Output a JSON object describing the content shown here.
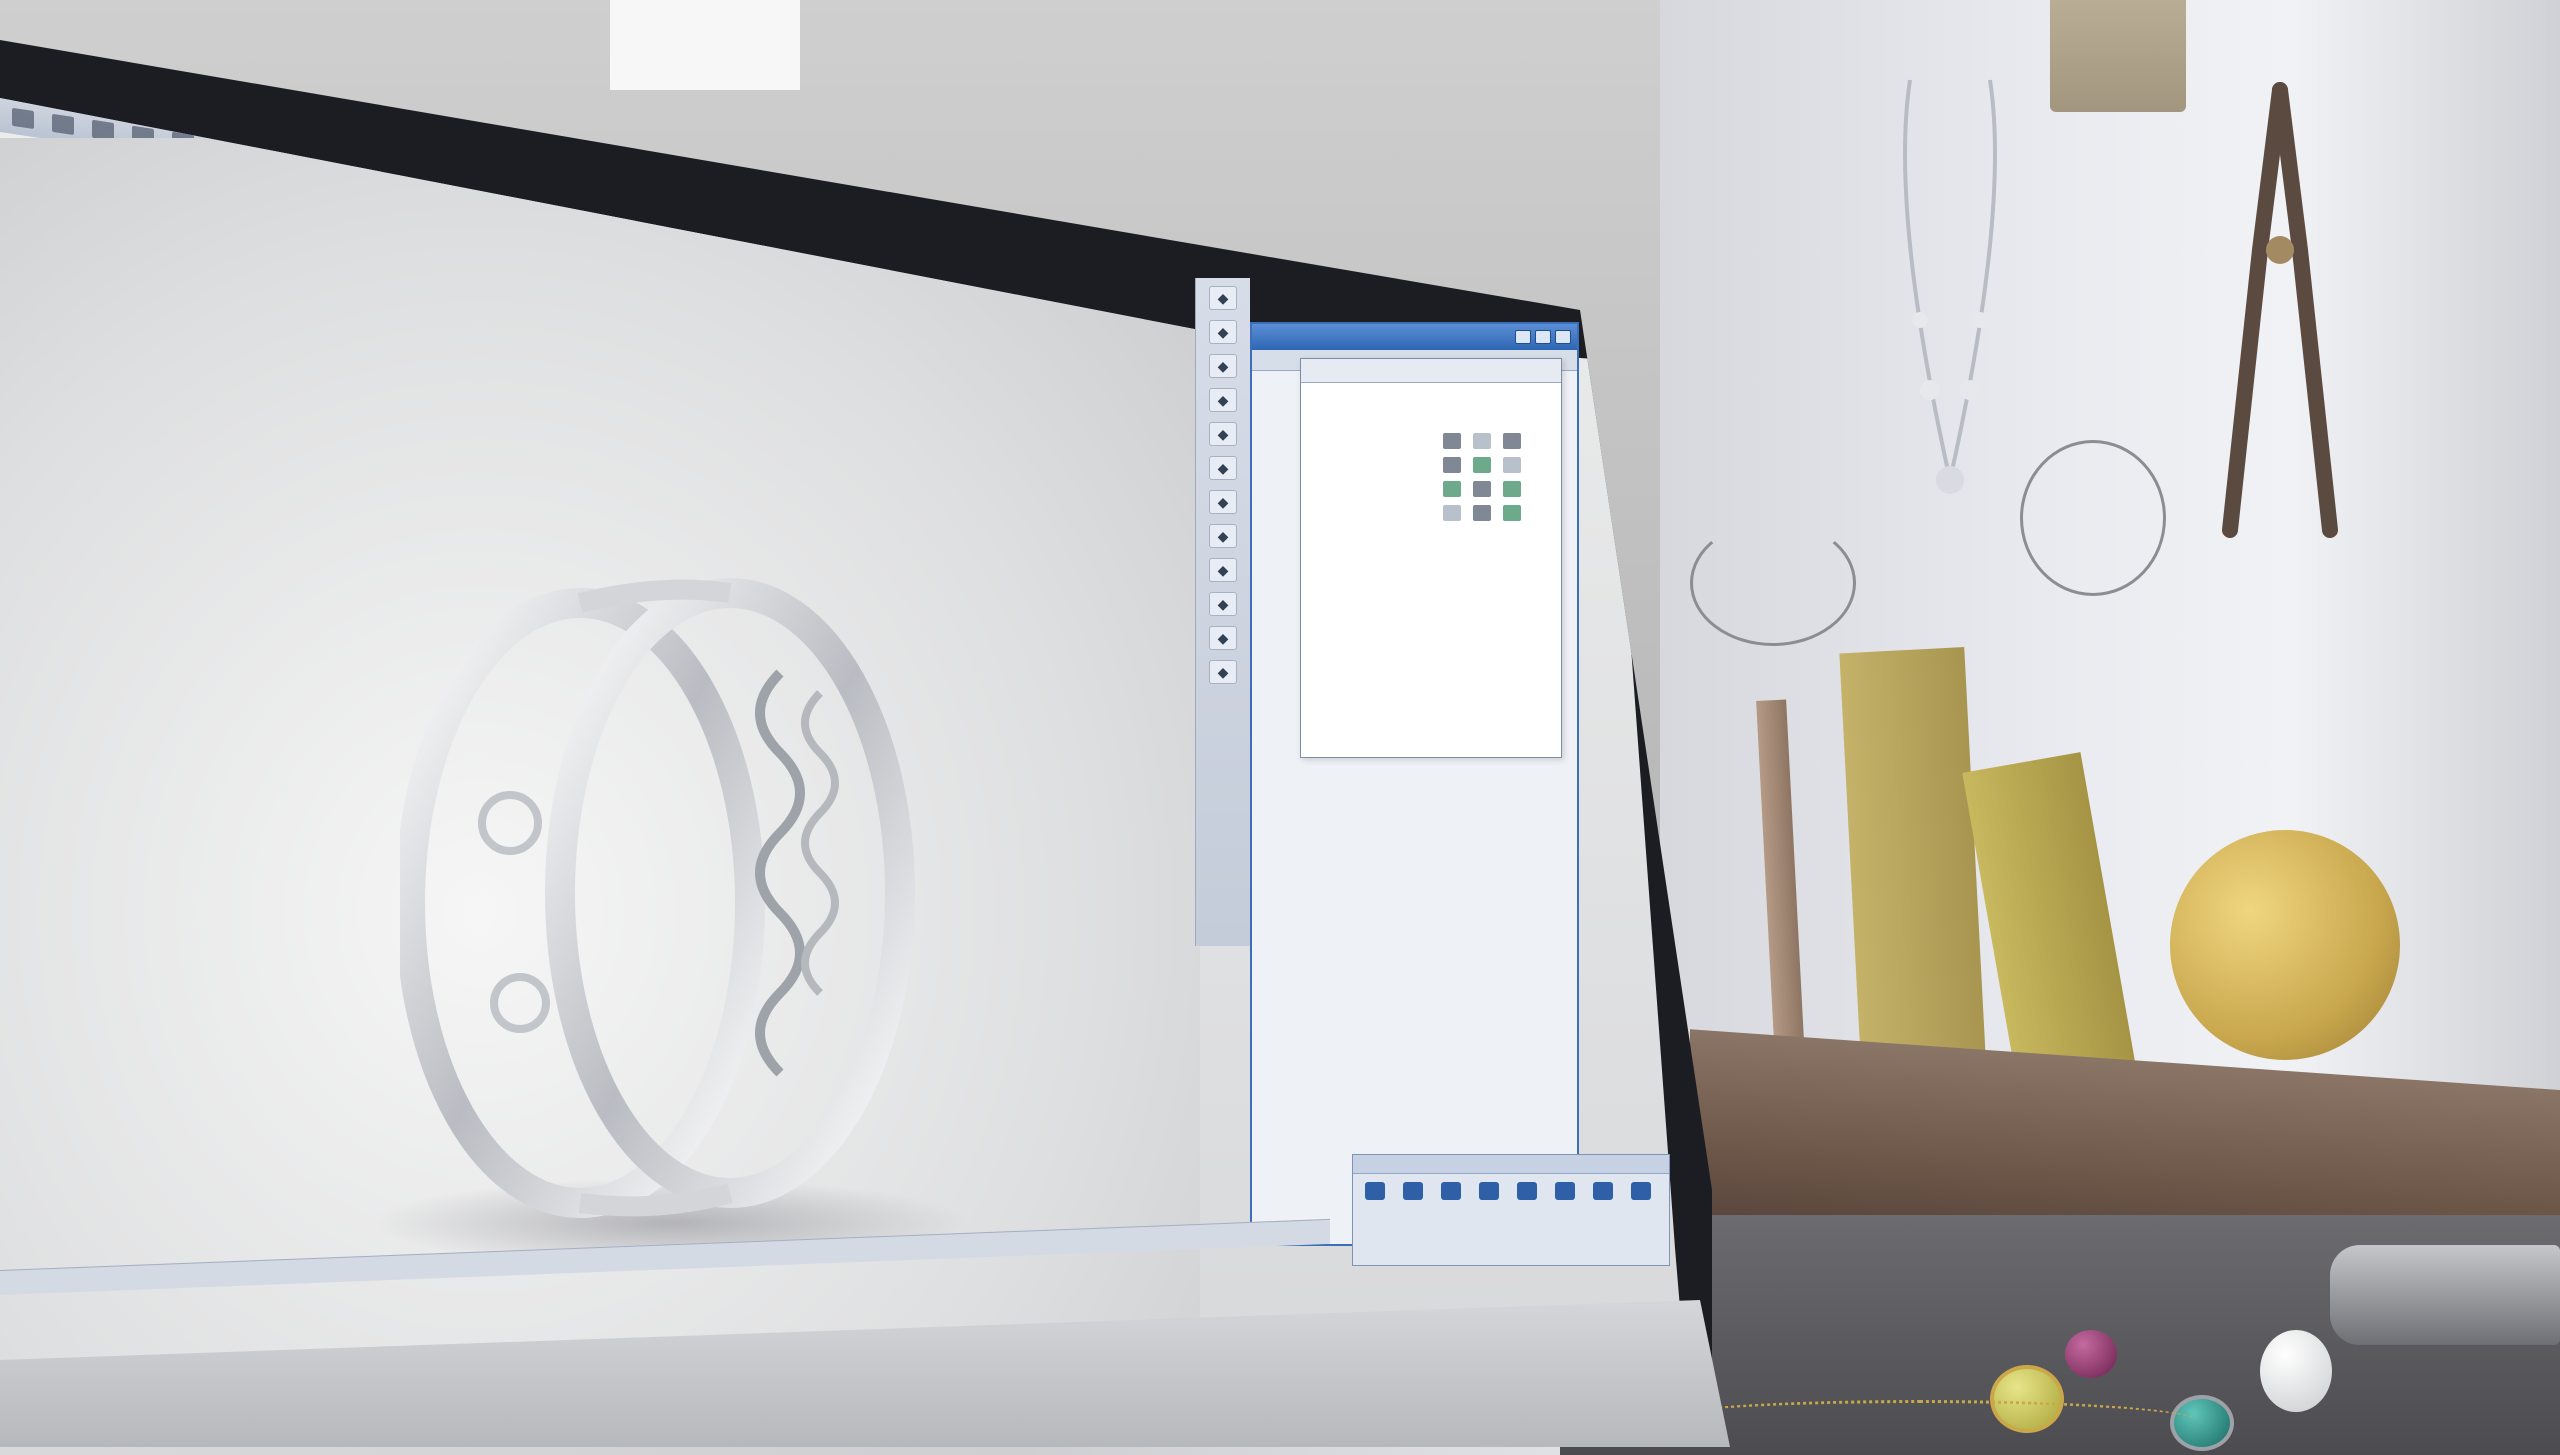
{
  "app": {
    "window_title": "",
    "menubar_icon_count": 16
  },
  "panel": {
    "title": "",
    "heading": "",
    "subwindow_title": "",
    "properties": [
      "",
      "",
      "",
      "",
      "",
      "",
      "",
      "",
      "",
      "",
      ""
    ],
    "status_text": ""
  },
  "toolbar": {
    "side_tools": [
      "select-icon",
      "rotate-icon",
      "move-icon",
      "scale-icon",
      "extrude-icon",
      "curve-icon",
      "boolean-icon",
      "fillet-icon",
      "mirror-icon",
      "array-icon",
      "measure-icon",
      "render-icon"
    ],
    "bottom_tools": [
      "play-icon",
      "camera-icon",
      "light-icon",
      "material-icon",
      "grid-icon",
      "settings-icon",
      "layers-icon",
      "export-icon"
    ]
  },
  "colors": {
    "accent": "#2f66b3",
    "panel_bg": "#eef1f6",
    "metal": "#c9cbd0",
    "gold": "#c9a84e"
  },
  "gems": [
    {
      "name": "amethyst-gem",
      "color": "#6b1f4d"
    },
    {
      "name": "peridot-gem",
      "color": "#a9a53a"
    },
    {
      "name": "emerald-gem",
      "color": "#1a6a63"
    },
    {
      "name": "moonstone-gem",
      "color": "#d9dbdd"
    }
  ]
}
